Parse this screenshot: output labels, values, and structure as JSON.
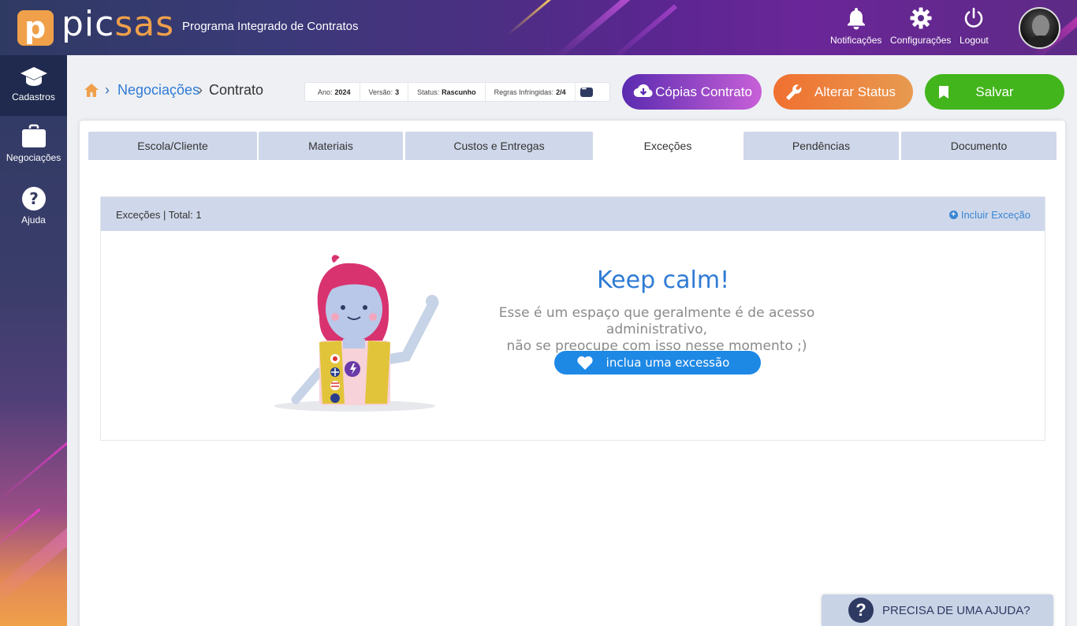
{
  "header": {
    "logo_mark": "p",
    "logo_text_a": "pic",
    "logo_text_b": "sas",
    "app_title": "Programa Integrado de Contratos",
    "actions": [
      {
        "label": "Notificações",
        "icon": "bell-icon"
      },
      {
        "label": "Configurações",
        "icon": "gear-icon"
      },
      {
        "label": "Logout",
        "icon": "power-icon"
      }
    ]
  },
  "sidebar": {
    "items": [
      {
        "label": "Cadastros",
        "icon": "graduation-cap-icon",
        "active": true
      },
      {
        "label": "Negociações",
        "icon": "briefcase-icon",
        "active": false
      },
      {
        "label": "Ajuda",
        "icon": "question-icon",
        "active": false
      }
    ]
  },
  "breadcrumb": {
    "link": "Negociações",
    "current": "Contrato"
  },
  "info": {
    "ano_label": "Ano:",
    "ano_value": "2024",
    "versao_label": "Versão:",
    "versao_value": "3",
    "status_label": "Status:",
    "status_value": "Rascunho",
    "regras_label": "Regras Infringidas:",
    "regras_value": "2/4"
  },
  "buttons": {
    "copias": "Cópias Contrato",
    "status": "Alterar Status",
    "salvar": "Salvar"
  },
  "tabs": [
    {
      "label": "Escola/Cliente"
    },
    {
      "label": "Materiais"
    },
    {
      "label": "Custos e Entregas"
    },
    {
      "label": "Exceções",
      "active": true
    },
    {
      "label": "Pendências"
    },
    {
      "label": "Documento"
    }
  ],
  "exceptions": {
    "title": "Exceções | Total: 1",
    "add_label": "Incluir Exceção",
    "empty_title": "Keep calm!",
    "empty_line1": "Esse é um espaço que geralmente é de acesso administrativo,",
    "empty_line2": "não se preocupe com isso nesse momento ;)",
    "include_button": "inclua uma excessão"
  },
  "help": {
    "label": "PRECISA DE UMA AJUDA?",
    "mark": "?"
  },
  "colors": {
    "accent_blue": "#2f7bd4",
    "brand_orange": "#f0a04a",
    "save_green": "#43b51c",
    "tab_bg": "#cfd8ea"
  }
}
